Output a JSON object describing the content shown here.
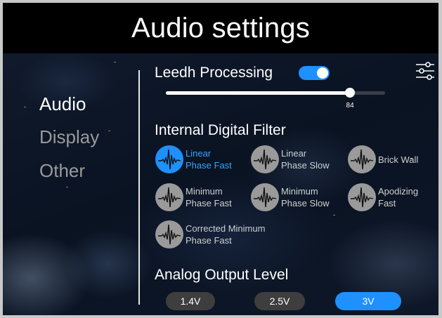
{
  "header": {
    "title": "Audio settings"
  },
  "nav": {
    "items": [
      {
        "label": "Audio",
        "active": true
      },
      {
        "label": "Display",
        "active": false
      },
      {
        "label": "Other",
        "active": false
      }
    ]
  },
  "leedh": {
    "label": "Leedh Processing",
    "enabled": true,
    "volume": {
      "value": 84,
      "value_label": "84",
      "min": 0,
      "max": 100
    }
  },
  "filter": {
    "title": "Internal Digital Filter",
    "options": [
      {
        "label": "Linear\nPhase Fast",
        "selected": true
      },
      {
        "label": "Linear\nPhase Slow",
        "selected": false
      },
      {
        "label": "Brick Wall",
        "selected": false
      },
      {
        "label": "Minimum\nPhase Fast",
        "selected": false
      },
      {
        "label": "Minimum\nPhase Slow",
        "selected": false
      },
      {
        "label": "Apodizing\nFast",
        "selected": false
      },
      {
        "label": "Corrected Minimum\nPhase Fast",
        "selected": false
      }
    ]
  },
  "output": {
    "title": "Analog Output Level",
    "options": [
      {
        "label": "1.4V",
        "selected": false
      },
      {
        "label": "2.5V",
        "selected": false
      },
      {
        "label": "3V",
        "selected": true
      }
    ]
  },
  "icons": {
    "settings": "sliders-icon",
    "filter": "impulse-response-icon"
  },
  "colors": {
    "accent": "#1e90ff",
    "inactive_text": "#9a9a9a",
    "header_bg": "#000000"
  }
}
